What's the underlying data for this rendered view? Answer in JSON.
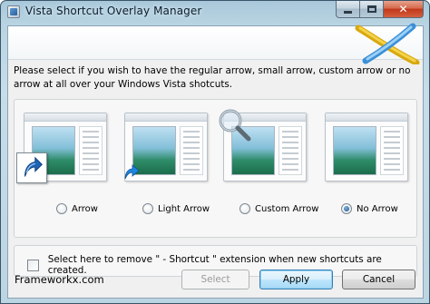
{
  "window": {
    "title": "Vista Shortcut Overlay Manager"
  },
  "instruction": "Please select if you wish to have the regular arrow, small arrow, custom arrow or no arrow at all over your Windows Vista shotcuts.",
  "options": [
    {
      "label": "Arrow",
      "checked": false,
      "icon": "large-shortcut-arrow-icon"
    },
    {
      "label": "Light Arrow",
      "checked": false,
      "icon": "small-shortcut-arrow-icon"
    },
    {
      "label": "Custom Arrow",
      "checked": false,
      "icon": "magnifier-icon"
    },
    {
      "label": "No Arrow",
      "checked": true,
      "icon": ""
    }
  ],
  "checkbox": {
    "label": "Select here to remove \" - Shortcut \" extension when new shortcuts are created.",
    "checked": false
  },
  "footer": {
    "link": "Frameworkx.com"
  },
  "buttons": {
    "select": "Select",
    "apply": "Apply",
    "cancel": "Cancel"
  },
  "colors": {
    "accent": "#3c7fb1",
    "arrow_blue": "#1f63b8",
    "logo_yellow": "#f2c21b"
  }
}
